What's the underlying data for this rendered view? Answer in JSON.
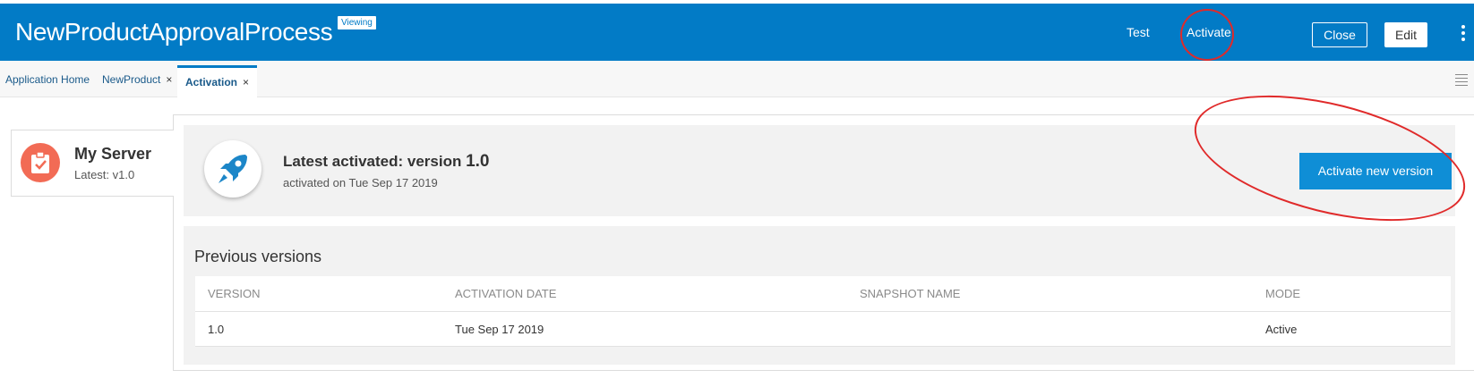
{
  "header": {
    "title": "NewProductApprovalProcess",
    "badge": "Viewing",
    "test_label": "Test",
    "activate_label": "Activate",
    "close_label": "Close",
    "edit_label": "Edit",
    "more_icon": "kebab-icon"
  },
  "tabs": [
    {
      "label": "Application Home",
      "closable": false,
      "active": false
    },
    {
      "label": "NewProduct",
      "closable": true,
      "active": false
    },
    {
      "label": "Activation",
      "closable": true,
      "active": true
    }
  ],
  "tab_close_glyph": "×",
  "server": {
    "name": "My Server",
    "latest": "Latest: v1.0",
    "icon": "clipboard-check-icon"
  },
  "latest": {
    "title_prefix": "Latest activated: version ",
    "version": "1.0",
    "subtitle": "activated on Tue Sep 17 2019",
    "icon": "rocket-icon",
    "activate_button": "Activate new version"
  },
  "previous": {
    "title": "Previous versions",
    "columns": [
      "VERSION",
      "ACTIVATION DATE",
      "SNAPSHOT NAME",
      "MODE"
    ],
    "rows": [
      [
        "1.0",
        "Tue Sep 17 2019",
        "",
        "Active"
      ]
    ]
  },
  "colors": {
    "brand": "#027bc6",
    "button": "#0f8ed6",
    "server_icon": "#f26b55",
    "annotation": "#e02a2a"
  }
}
